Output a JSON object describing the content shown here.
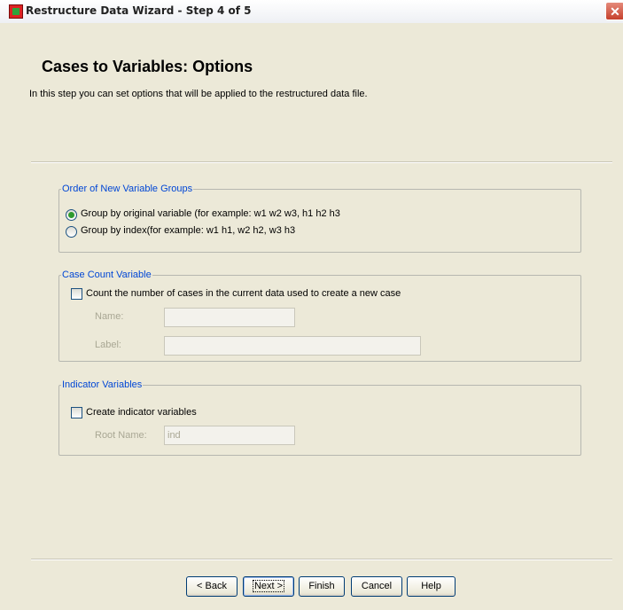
{
  "window": {
    "title": "Restructure Data Wizard - Step 4 of 5",
    "close_label": "✕"
  },
  "page": {
    "title": "Cases to Variables: Options",
    "subtitle": "In this step you can set options that will be applied to the restructured data file."
  },
  "order_group": {
    "legend": "Order of New Variable Groups",
    "options": [
      {
        "label": "Group by original variable (for example: w1 w2 w3, h1 h2 h3",
        "selected": true
      },
      {
        "label": "Group by index(for example: w1 h1, w2 h2, w3 h3",
        "selected": false
      }
    ]
  },
  "case_count_group": {
    "legend": "Case Count Variable",
    "checkbox_label": "Count the number of cases in the current data used to create a new case",
    "checked": false,
    "name_label": "Name:",
    "name_value": "",
    "label_label": "Label:",
    "label_value": ""
  },
  "indicator_group": {
    "legend": "Indicator Variables",
    "checkbox_label": "Create indicator variables",
    "checked": false,
    "root_name_label": "Root Name:",
    "root_name_value": "ind"
  },
  "buttons": {
    "back": "< Back",
    "next": "Next >",
    "finish": "Finish",
    "cancel": "Cancel",
    "help": "Help"
  }
}
